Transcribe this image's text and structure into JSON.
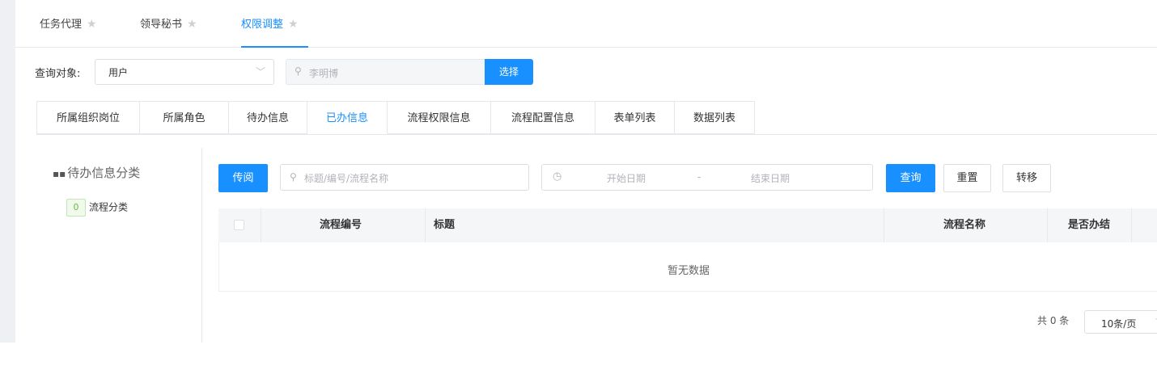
{
  "top_tabs": [
    {
      "label": "任务代理",
      "active": false
    },
    {
      "label": "领导秘书",
      "active": false
    },
    {
      "label": "权限调整",
      "active": true
    }
  ],
  "query": {
    "label": "查询对象:",
    "object_value": "用户",
    "user_placeholder": "李明博",
    "select_button": "选择"
  },
  "sub_tabs": [
    "所属组织岗位",
    "所属角色",
    "待办信息",
    "已办信息",
    "流程权限信息",
    "流程配置信息",
    "表单列表",
    "数据列表"
  ],
  "sub_tab_active": "已办信息",
  "category": {
    "title": "待办信息分类",
    "items": [
      {
        "count": "0",
        "label": "流程分类"
      }
    ]
  },
  "toolbar": {
    "pass_button": "传阅",
    "keyword_placeholder": "标题/编号/流程名称",
    "start_date_placeholder": "开始日期",
    "date_separator": "-",
    "end_date_placeholder": "结束日期",
    "query_button": "查询",
    "reset_button": "重置",
    "transfer_button": "转移"
  },
  "table": {
    "columns": [
      "流程编号",
      "标题",
      "流程名称",
      "是否办结"
    ],
    "empty_text": "暂无数据"
  },
  "pagination": {
    "total_text": "共 0 条",
    "page_size": "10条/页"
  },
  "colors": {
    "primary": "#1890ff",
    "badge_green": "#67c23a"
  }
}
